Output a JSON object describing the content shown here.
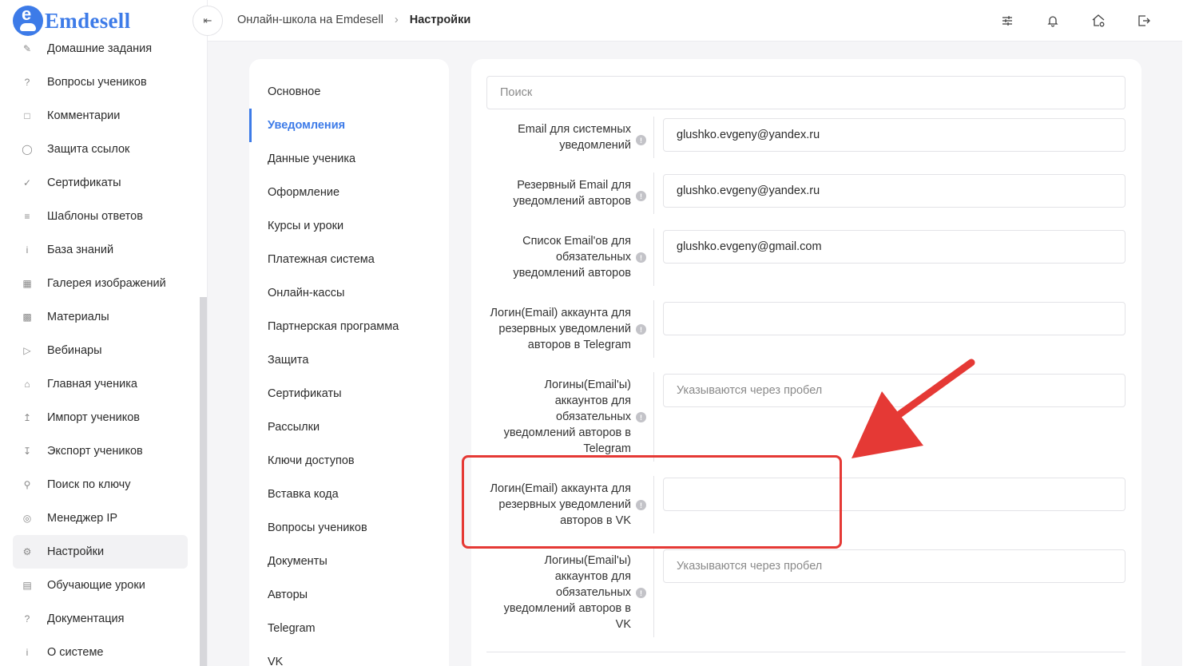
{
  "app": {
    "logo_text": "Emdesell",
    "logo_letter": "e"
  },
  "sidebar": {
    "items": [
      {
        "label": "Домашние задания",
        "icon": "pencil-icon"
      },
      {
        "label": "Вопросы учеников",
        "icon": "question-icon"
      },
      {
        "label": "Комментарии",
        "icon": "comment-icon"
      },
      {
        "label": "Защита ссылок",
        "icon": "shield-icon"
      },
      {
        "label": "Сертификаты",
        "icon": "check-circle-icon"
      },
      {
        "label": "Шаблоны ответов",
        "icon": "list-icon"
      },
      {
        "label": "База знаний",
        "icon": "info-icon"
      },
      {
        "label": "Галерея изображений",
        "icon": "image-icon"
      },
      {
        "label": "Материалы",
        "icon": "briefcase-icon"
      },
      {
        "label": "Вебинары",
        "icon": "play-icon"
      },
      {
        "label": "Главная ученика",
        "icon": "home-gear-icon"
      },
      {
        "label": "Импорт учеников",
        "icon": "upload-icon"
      },
      {
        "label": "Экспорт учеников",
        "icon": "download-icon"
      },
      {
        "label": "Поиск по ключу",
        "icon": "search-icon"
      },
      {
        "label": "Менеджер IP",
        "icon": "target-icon"
      },
      {
        "label": "Настройки",
        "icon": "gear-icon",
        "active": true
      },
      {
        "label": "Обучающие уроки",
        "icon": "film-icon"
      },
      {
        "label": "Документация",
        "icon": "help-doc-icon"
      },
      {
        "label": "О системе",
        "icon": "info-box-icon"
      }
    ]
  },
  "header": {
    "breadcrumb": {
      "root": "Онлайн-школа на Emdesell",
      "current": "Настройки"
    },
    "icons": [
      "sliders-icon",
      "bell-icon",
      "home-gear-icon",
      "logout-icon"
    ]
  },
  "settings_menu": {
    "items": [
      {
        "label": "Основное"
      },
      {
        "label": "Уведомления",
        "active": true
      },
      {
        "label": "Данные ученика"
      },
      {
        "label": "Оформление"
      },
      {
        "label": "Курсы и уроки"
      },
      {
        "label": "Платежная система"
      },
      {
        "label": "Онлайн-кассы"
      },
      {
        "label": "Партнерская программа"
      },
      {
        "label": "Защита"
      },
      {
        "label": "Сертификаты"
      },
      {
        "label": "Рассылки"
      },
      {
        "label": "Ключи доступов"
      },
      {
        "label": "Вставка кода"
      },
      {
        "label": "Вопросы учеников"
      },
      {
        "label": "Документы"
      },
      {
        "label": "Авторы"
      },
      {
        "label": "Telegram"
      },
      {
        "label": "VK"
      }
    ]
  },
  "form": {
    "search_placeholder": "Поиск",
    "rows": [
      {
        "label_lines": [
          "Email для системных",
          "уведомлений"
        ],
        "value": "glushko.evgeny@yandex.ru",
        "placeholder": ""
      },
      {
        "label_lines": [
          "Резервный Email для",
          "уведомлений авторов"
        ],
        "value": "glushko.evgeny@yandex.ru",
        "placeholder": ""
      },
      {
        "label_lines": [
          "Список Email'ов для",
          "обязательных",
          "уведомлений авторов"
        ],
        "value": "glushko.evgeny@gmail.com",
        "placeholder": ""
      },
      {
        "label_lines": [
          "Логин(Email) аккаунта для",
          "резервных уведомлений",
          "авторов в Telegram"
        ],
        "value": "",
        "placeholder": ""
      },
      {
        "label_lines": [
          "Логины(Email'ы)",
          "аккаунтов для",
          "обязательных",
          "уведомлений авторов в",
          "Telegram"
        ],
        "value": "",
        "placeholder": "Указываются через пробел"
      },
      {
        "label_lines": [
          "Логин(Email) аккаунта для",
          "резервных уведомлений",
          "авторов в VK"
        ],
        "value": "",
        "placeholder": ""
      },
      {
        "label_lines": [
          "Логины(Email'ы)",
          "аккаунтов для",
          "обязательных",
          "уведомлений авторов в",
          "VK"
        ],
        "value": "",
        "placeholder": "Указываются через пробел"
      }
    ]
  },
  "annotation": {
    "color": "#e53935",
    "highlighted_row": 5
  },
  "colors": {
    "accent": "#3d7be8",
    "background": "#f5f5f7"
  }
}
